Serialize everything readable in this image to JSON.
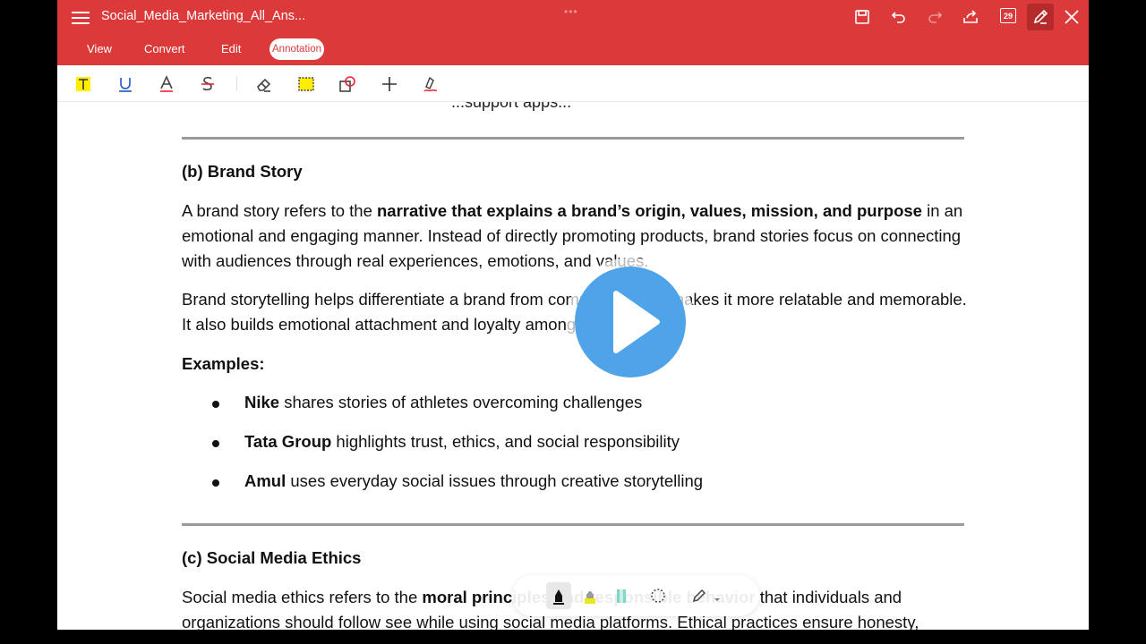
{
  "header": {
    "doc_title": "Social_Media_Marketing_All_Ans...",
    "drag_handle": "•••",
    "page_badge": "29",
    "tabs": [
      {
        "label": "View"
      },
      {
        "label": "Convert"
      },
      {
        "label": "Edit"
      },
      {
        "label": "Annotation"
      }
    ]
  },
  "annotation_tools": [
    "text-highlight-icon",
    "underline-icon",
    "text-color-icon",
    "strikethrough-icon",
    "eraser-icon",
    "area-highlight-icon",
    "shapes-icon",
    "add-icon",
    "signature-pen-icon"
  ],
  "colors": {
    "header": "#dc3a3a",
    "highlight": "#ffee00",
    "play": "#4fa3e8"
  },
  "document": {
    "cut_top": "...support apps...",
    "section_b": {
      "heading": "(b) Brand Story",
      "p1_a": "A brand story refers to the ",
      "p1_bold": "narrative that explains a brand’s origin, values, mission, and purpose",
      "p1_b": " in an emotional and engaging manner. Instead of directly promoting products, brand stories focus on connecting with audiences through real experiences, emotions, and values.",
      "p2": "Brand storytelling helps differentiate a brand from competitors and makes it more relatable and memorable. It also builds emotional attachment and loyalty among customers.",
      "examples_label": "Examples:",
      "examples": [
        {
          "name": "Nike",
          "text": " shares stories of athletes overcoming challenges"
        },
        {
          "name": "Tata Group",
          "text": " highlights trust, ethics, and social responsibility"
        },
        {
          "name": "Amul",
          "text": " uses everyday social issues through creative storytelling"
        }
      ]
    },
    "section_c": {
      "heading": "(c) Social Media Ethics",
      "p1_a": "Social media ethics refers to the ",
      "p1_bold_a": "moral principles and responsible ",
      "p1_bold_b": "behavior",
      "p1_b": " that individuals and organizations should follow see while using social media platforms. Ethical practices ensure honesty,"
    }
  },
  "pen_tools": [
    "pen-black-icon",
    "highlighter-yellow-icon",
    "highlighter-teal-icon",
    "lasso-icon",
    "pen-style-icon"
  ]
}
